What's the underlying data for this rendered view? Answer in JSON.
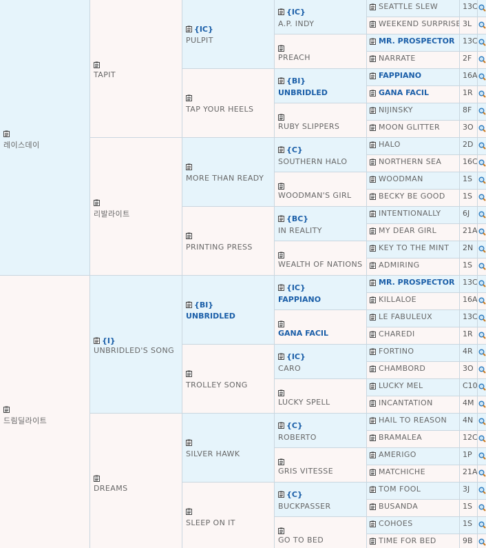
{
  "gen1": [
    {
      "name": "레이스데이",
      "tag": "",
      "highlight": false,
      "bg": "blue"
    },
    {
      "name": "드림딜라이트",
      "tag": "",
      "highlight": false,
      "bg": "pink"
    }
  ],
  "gen2": [
    {
      "name": "TAPIT",
      "tag": "",
      "highlight": false,
      "bg": "pink"
    },
    {
      "name": "리발라이트",
      "tag": "",
      "highlight": false,
      "bg": "pink"
    },
    {
      "name": "UNBRIDLED'S SONG",
      "tag": "{I}",
      "highlight": false,
      "bg": "blue"
    },
    {
      "name": "DREAMS",
      "tag": "",
      "highlight": false,
      "bg": "pink"
    }
  ],
  "gen3": [
    {
      "name": "PULPIT",
      "tag": "{IC}",
      "highlight": false,
      "bg": "blue"
    },
    {
      "name": "TAP YOUR HEELS",
      "tag": "",
      "highlight": false,
      "bg": "pink"
    },
    {
      "name": "MORE THAN READY",
      "tag": "",
      "highlight": false,
      "bg": "blue"
    },
    {
      "name": "PRINTING PRESS",
      "tag": "",
      "highlight": false,
      "bg": "pink"
    },
    {
      "name": "UNBRIDLED",
      "tag": "{BI}",
      "highlight": true,
      "bg": "blue"
    },
    {
      "name": "TROLLEY SONG",
      "tag": "",
      "highlight": false,
      "bg": "pink"
    },
    {
      "name": "SILVER HAWK",
      "tag": "",
      "highlight": false,
      "bg": "blue"
    },
    {
      "name": "SLEEP ON IT",
      "tag": "",
      "highlight": false,
      "bg": "pink"
    }
  ],
  "gen4": [
    {
      "name": "A.P. INDY",
      "tag": "{IC}",
      "highlight": false,
      "bg": "blue"
    },
    {
      "name": "PREACH",
      "tag": "",
      "highlight": false,
      "bg": "pink"
    },
    {
      "name": "UNBRIDLED",
      "tag": "{BI}",
      "highlight": true,
      "bg": "blue"
    },
    {
      "name": "RUBY SLIPPERS",
      "tag": "",
      "highlight": false,
      "bg": "pink"
    },
    {
      "name": "SOUTHERN HALO",
      "tag": "{C}",
      "highlight": false,
      "bg": "blue"
    },
    {
      "name": "WOODMAN'S GIRL",
      "tag": "",
      "highlight": false,
      "bg": "pink"
    },
    {
      "name": "IN REALITY",
      "tag": "{BC}",
      "highlight": false,
      "bg": "blue"
    },
    {
      "name": "WEALTH OF NATIONS",
      "tag": "",
      "highlight": false,
      "bg": "pink"
    },
    {
      "name": "FAPPIANO",
      "tag": "{IC}",
      "highlight": true,
      "bg": "blue"
    },
    {
      "name": "GANA FACIL",
      "tag": "",
      "highlight": true,
      "bg": "pink"
    },
    {
      "name": "CARO",
      "tag": "{IC}",
      "highlight": false,
      "bg": "blue"
    },
    {
      "name": "LUCKY SPELL",
      "tag": "",
      "highlight": false,
      "bg": "pink"
    },
    {
      "name": "ROBERTO",
      "tag": "{C}",
      "highlight": false,
      "bg": "blue"
    },
    {
      "name": "GRIS VITESSE",
      "tag": "",
      "highlight": false,
      "bg": "pink"
    },
    {
      "name": "BUCKPASSER",
      "tag": "{C}",
      "highlight": false,
      "bg": "blue"
    },
    {
      "name": "GO TO BED",
      "tag": "",
      "highlight": false,
      "bg": "pink"
    }
  ],
  "gen5": [
    {
      "name": "SEATTLE SLEW",
      "code": "13C",
      "highlight": false,
      "bg": "blue"
    },
    {
      "name": "WEEKEND SURPRISE",
      "code": "3L",
      "highlight": false,
      "bg": "pink"
    },
    {
      "name": "MR. PROSPECTOR",
      "code": "13C",
      "highlight": true,
      "bg": "blue"
    },
    {
      "name": "NARRATE",
      "code": "2F",
      "highlight": false,
      "bg": "pink"
    },
    {
      "name": "FAPPIANO",
      "code": "16A",
      "highlight": true,
      "bg": "blue"
    },
    {
      "name": "GANA FACIL",
      "code": "1R",
      "highlight": true,
      "bg": "pink"
    },
    {
      "name": "NIJINSKY",
      "code": "8F",
      "highlight": false,
      "bg": "blue"
    },
    {
      "name": "MOON GLITTER",
      "code": "3O",
      "highlight": false,
      "bg": "pink"
    },
    {
      "name": "HALO",
      "code": "2D",
      "highlight": false,
      "bg": "blue"
    },
    {
      "name": "NORTHERN SEA",
      "code": "16C",
      "highlight": false,
      "bg": "pink"
    },
    {
      "name": "WOODMAN",
      "code": "1S",
      "highlight": false,
      "bg": "blue"
    },
    {
      "name": "BECKY BE GOOD",
      "code": "1S",
      "highlight": false,
      "bg": "pink"
    },
    {
      "name": "INTENTIONALLY",
      "code": "6J",
      "highlight": false,
      "bg": "blue"
    },
    {
      "name": "MY DEAR GIRL",
      "code": "21A",
      "highlight": false,
      "bg": "pink"
    },
    {
      "name": "KEY TO THE MINT",
      "code": "2N",
      "highlight": false,
      "bg": "blue"
    },
    {
      "name": "ADMIRING",
      "code": "1S",
      "highlight": false,
      "bg": "pink"
    },
    {
      "name": "MR. PROSPECTOR",
      "code": "13C",
      "highlight": true,
      "bg": "blue"
    },
    {
      "name": "KILLALOE",
      "code": "16A",
      "highlight": false,
      "bg": "pink"
    },
    {
      "name": "LE FABULEUX",
      "code": "13C",
      "highlight": false,
      "bg": "blue"
    },
    {
      "name": "CHAREDI",
      "code": "1R",
      "highlight": false,
      "bg": "pink"
    },
    {
      "name": "FORTINO",
      "code": "4R",
      "highlight": false,
      "bg": "blue"
    },
    {
      "name": "CHAMBORD",
      "code": "3O",
      "highlight": false,
      "bg": "pink"
    },
    {
      "name": "LUCKY MEL",
      "code": "C10",
      "highlight": false,
      "bg": "blue"
    },
    {
      "name": "INCANTATION",
      "code": "4M",
      "highlight": false,
      "bg": "pink"
    },
    {
      "name": "HAIL TO REASON",
      "code": "4N",
      "highlight": false,
      "bg": "blue"
    },
    {
      "name": "BRAMALEA",
      "code": "12C",
      "highlight": false,
      "bg": "pink"
    },
    {
      "name": "AMERIGO",
      "code": "1P",
      "highlight": false,
      "bg": "blue"
    },
    {
      "name": "MATCHICHE",
      "code": "21A",
      "highlight": false,
      "bg": "pink"
    },
    {
      "name": "TOM FOOL",
      "code": "3J",
      "highlight": false,
      "bg": "blue"
    },
    {
      "name": "BUSANDA",
      "code": "1S",
      "highlight": false,
      "bg": "pink"
    },
    {
      "name": "COHOES",
      "code": "1S",
      "highlight": false,
      "bg": "blue"
    },
    {
      "name": "TIME FOR BED",
      "code": "9B",
      "highlight": false,
      "bg": "pink"
    }
  ],
  "icons": {
    "clip": "clipboard-icon",
    "search": "magnifier-icon"
  },
  "colors": {
    "blue_bg": "#e6f4fb",
    "pink_bg": "#fcf6f5",
    "link": "#1a5ea8",
    "border": "#c9d6df"
  }
}
